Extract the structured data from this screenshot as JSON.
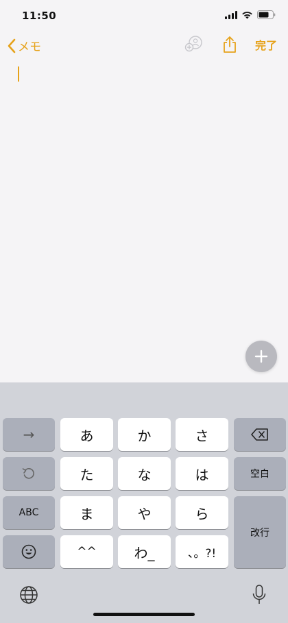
{
  "status": {
    "time": "11:50"
  },
  "nav": {
    "back_label": "メモ",
    "done_label": "完了"
  },
  "keyboard": {
    "arrow": "→",
    "row1": [
      "あ",
      "か",
      "さ"
    ],
    "row2": [
      "た",
      "な",
      "は"
    ],
    "row3": [
      "ま",
      "や",
      "ら"
    ],
    "row4": [
      "^^",
      "わ_",
      "、。?!"
    ],
    "space": "空白",
    "abc": "ABC",
    "return": "改行"
  },
  "colors": {
    "accent": "#e6a21a",
    "keyboard_bg": "#d1d3d9",
    "key_dark": "#abafba",
    "key_light": "#ffffff"
  }
}
